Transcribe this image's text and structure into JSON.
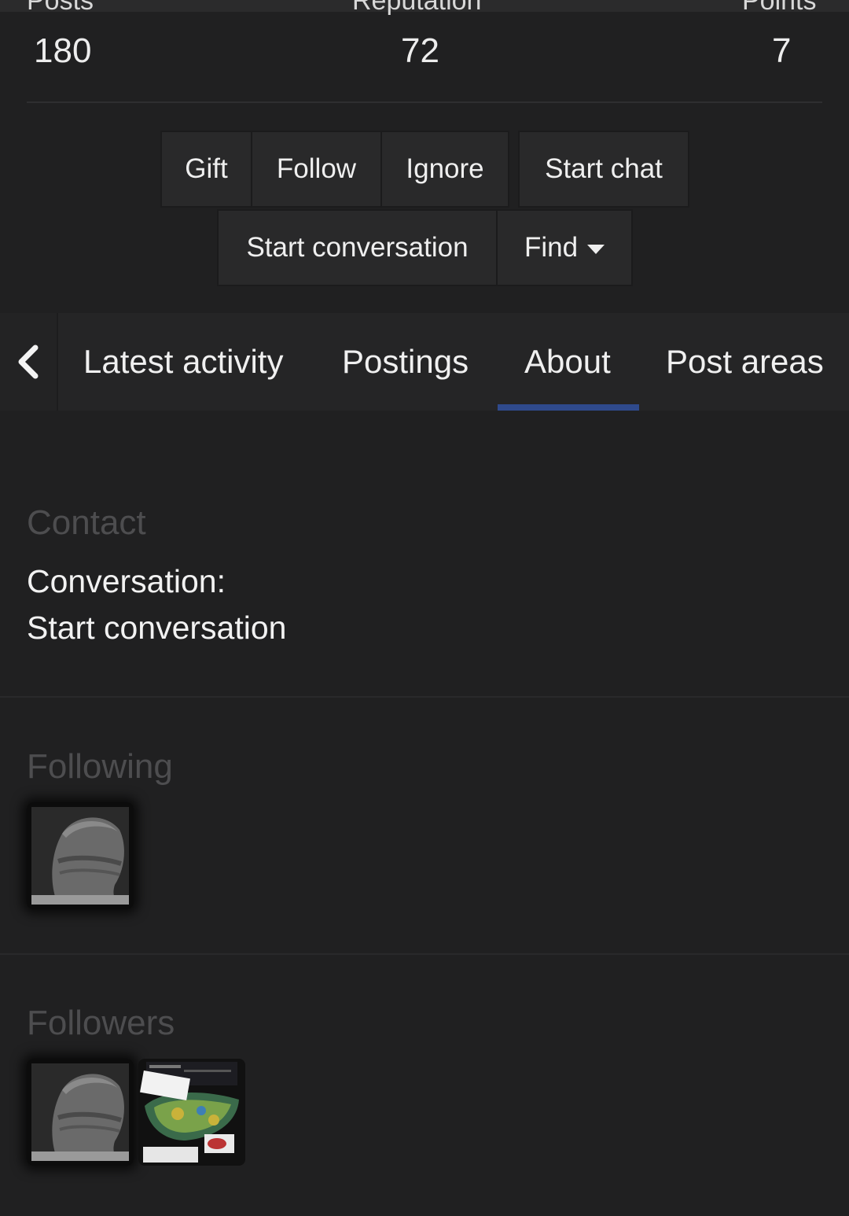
{
  "stats": [
    {
      "label": "Posts",
      "value": "180"
    },
    {
      "label": "Reputation",
      "value": "72"
    },
    {
      "label": "Points",
      "value": "7"
    }
  ],
  "actions": {
    "gift": "Gift",
    "follow": "Follow",
    "ignore": "Ignore",
    "start_chat": "Start chat",
    "start_conversation": "Start conversation",
    "find": "Find"
  },
  "tabs": [
    {
      "label": "Latest activity"
    },
    {
      "label": "Postings"
    },
    {
      "label": "About",
      "active": true
    },
    {
      "label": "Post areas"
    }
  ],
  "about": {
    "contact": {
      "title": "Contact",
      "conversation_label": "Conversation:",
      "conversation_link": "Start conversation"
    },
    "following": {
      "title": "Following",
      "count": 1
    },
    "followers": {
      "title": "Followers",
      "count": 2
    }
  },
  "colors": {
    "accent": "#2f4a8c",
    "background": "#202021"
  }
}
